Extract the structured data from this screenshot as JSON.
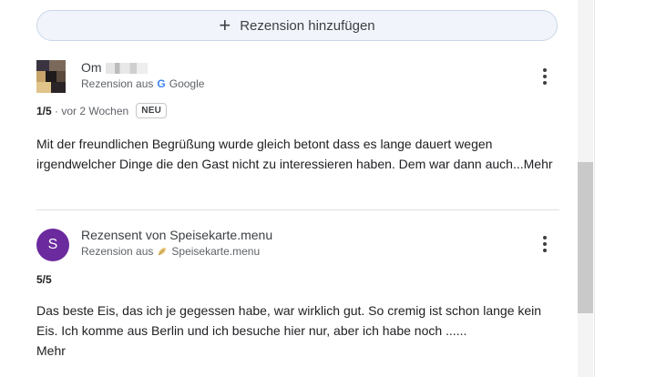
{
  "add_review": {
    "label": "Rezension hinzufügen",
    "icon": "plus-icon"
  },
  "reviews": [
    {
      "author": "Om",
      "source_prefix": "Rezension aus",
      "source_name": "Google",
      "source_letter": "G",
      "rating": "1/5",
      "time": "· vor 2 Wochen",
      "badge": "NEU",
      "text": "Mit der freundlichen Begrüßung wurde gleich betont dass es lange dauert wegen irgendwelcher Dinge die den Gast nicht zu interessieren haben. Dem war dann auch...",
      "more": "Mehr"
    },
    {
      "avatar_letter": "S",
      "author": "Rezensent von Speisekarte.menu",
      "source_prefix": "Rezension aus",
      "source_name": "Speisekarte.menu",
      "rating": "5/5",
      "text": "Das beste Eis, das ich je gegessen habe, war wirklich gut. So cremig ist schon lange kein Eis. Ich komme aus Berlin und ich besuche hier nur, aber ich habe noch ......",
      "more": "Mehr"
    }
  ],
  "colors": {
    "avatar_purple": "#6b2a9e",
    "google_blue": "#4285f4",
    "pill_bg": "#f1f5fb"
  }
}
